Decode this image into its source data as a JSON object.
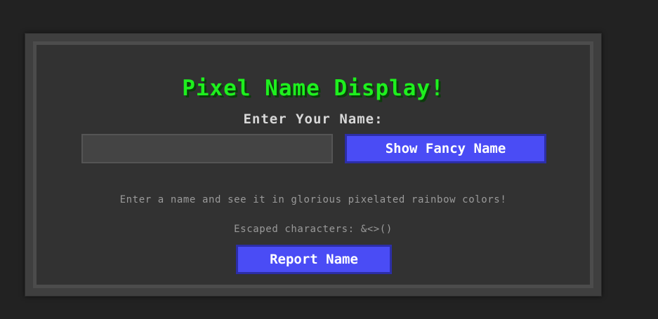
{
  "app": {
    "title": "Pixel Name Display!",
    "input_label": "Enter Your Name:",
    "input_value": "",
    "input_placeholder": "",
    "show_button_label": "Show Fancy Name",
    "description": "Enter a name and see it in glorious pixelated rainbow colors!",
    "escaped_text": "Escaped characters: &<>()",
    "report_button_label": "Report Name"
  },
  "colors": {
    "background": "#222222",
    "panel": "#323232",
    "title": "#1ef01e",
    "button": "#4a4cf5",
    "muted_text": "#9a9a9a"
  }
}
